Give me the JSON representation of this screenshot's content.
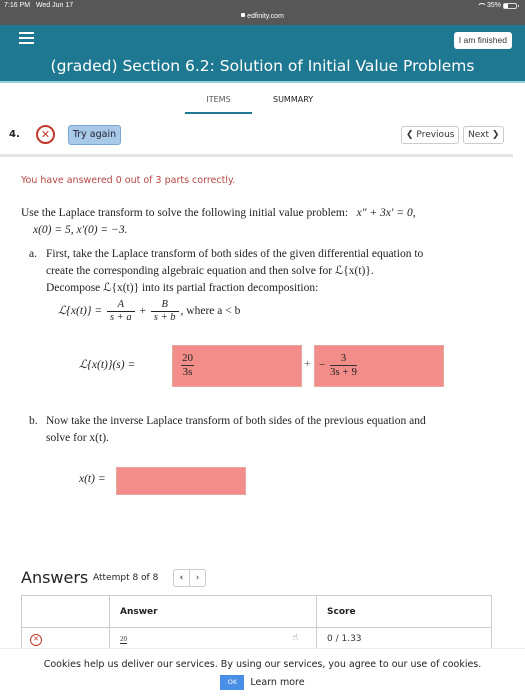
{
  "status_bar": {
    "time": "7:16 PM",
    "date": "Wed Jun 17",
    "url": "edfinity.com",
    "battery_text": "35%",
    "battery_level": 0.35
  },
  "header": {
    "menu_icon": "hamburger-icon",
    "finished_label": "I am finished",
    "title": "(graded) Section 6.2: Solution of Initial Value Problems",
    "colors": {
      "header_bg": "#1e7891",
      "accent_line": "#9bd0de"
    }
  },
  "tabs": [
    {
      "label": "ITEMS",
      "active": true
    },
    {
      "label": "SUMMARY",
      "active": false
    }
  ],
  "question": {
    "number": "4.",
    "status_icon": "incorrect-x-icon",
    "try_again_label": "Try again",
    "previous_label": "Previous",
    "next_label": "Next",
    "status_message": "You have answered 0 out of 3 parts correctly.",
    "intro_text": "Use the Laplace transform to solve the following initial value problem:",
    "equation": "x″ + 3x′ = 0,",
    "initial_conditions": "x(0) = 5,   x′(0) = −3.",
    "part_a": {
      "label": "a.",
      "line1": "First, take the Laplace transform of both sides of the given differential equation to",
      "line2": "create the corresponding algebraic equation and then solve for ℒ{x(t)}.",
      "line3": "Decompose ℒ{x(t)} into its partial fraction decomposition:",
      "formula_lhs": "ℒ{x(t)} =",
      "frac1_num": "A",
      "frac1_den": "s + a",
      "plus": "+",
      "frac2_num": "B",
      "frac2_den": "s + b",
      "formula_tail": ", where a < b",
      "answer_lhs": "ℒ{x(t)}(s) =",
      "answer1_num": "20",
      "answer1_den": "3s",
      "answer_plus": "+",
      "answer2_sign": "−",
      "answer2_num": "3",
      "answer2_den": "3s + 9"
    },
    "part_b": {
      "label": "b.",
      "line1": "Now take the inverse Laplace transform of both sides of the previous equation and",
      "line2": "solve for x(t).",
      "answer_lhs": "x(t) =",
      "answer_value": ""
    },
    "colors": {
      "incorrect_fill": "#f28d89",
      "error_text": "#b84444",
      "try_again_bg": "#a9c9e8"
    }
  },
  "answers": {
    "title": "Answers",
    "attempt": "Attempt 8 of 8",
    "prev_glyph": "‹",
    "next_glyph": "›",
    "columns": [
      "",
      "Answer",
      "Score"
    ],
    "rows": [
      {
        "status_icon": "incorrect-x-icon",
        "answer": "20",
        "score": "0 / 1.33"
      }
    ]
  },
  "cookie_banner": {
    "text": "Cookies help us deliver our services. By using our services, you agree to our use of cookies.",
    "ok_label": "OK",
    "learn_more_label": "Learn more"
  }
}
